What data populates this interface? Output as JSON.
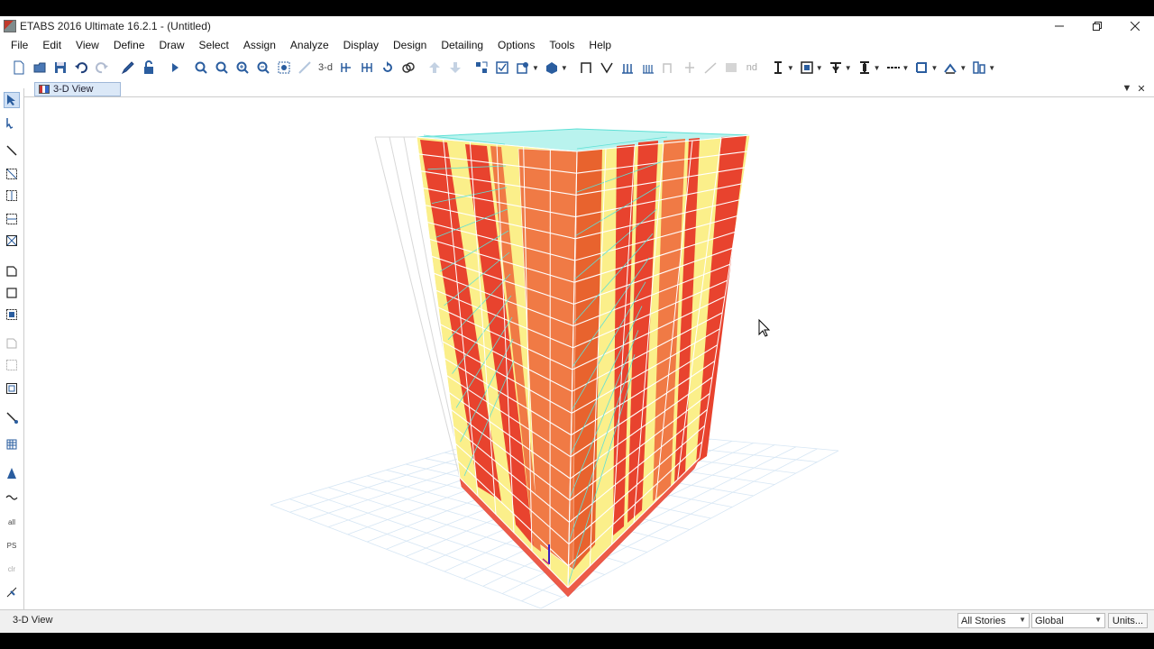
{
  "window": {
    "title": "ETABS 2016 Ultimate 16.2.1 - (Untitled)",
    "controls": [
      "minimize",
      "restore",
      "close"
    ]
  },
  "menu": [
    "File",
    "Edit",
    "View",
    "Define",
    "Draw",
    "Select",
    "Assign",
    "Analyze",
    "Display",
    "Design",
    "Detailing",
    "Options",
    "Tools",
    "Help"
  ],
  "toolbar": {
    "view_3d_label": "3-d",
    "nd_label": "nd"
  },
  "tab": {
    "label": "3-D View"
  },
  "lefttools_labels": {
    "all": "all",
    "ps": "PS",
    "clr": "clr"
  },
  "status": {
    "view_name": "3-D View",
    "story_select": "All Stories",
    "coord_select": "Global",
    "units_button": "Units..."
  },
  "colors": {
    "column": "#e8432e",
    "wall_orange": "#f07a45",
    "wall_yellow": "#fbef8a",
    "slab_cyan": "#5fe0d6",
    "frame_white": "#ffffff",
    "grid": "#bcd8f0"
  }
}
